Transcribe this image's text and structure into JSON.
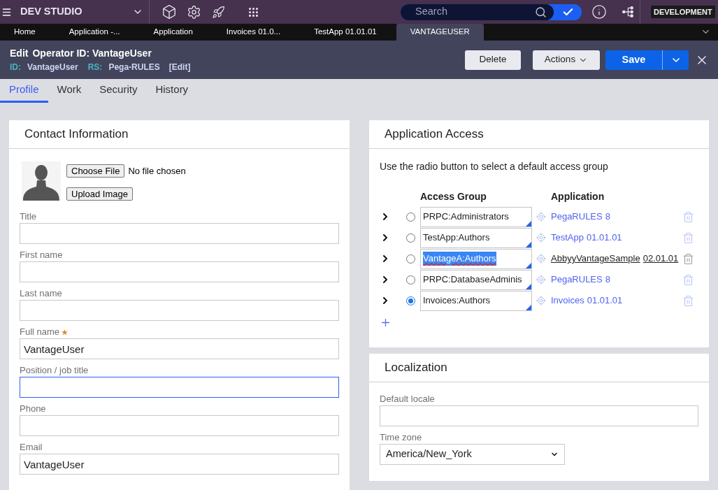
{
  "top_bar": {
    "title": "DEV STUDIO",
    "search": {
      "placeholder": "Search"
    },
    "environment": "DEVELOPMENT"
  },
  "document_tabs": [
    {
      "label": "Home",
      "selected": false
    },
    {
      "label": "Application -...",
      "selected": false
    },
    {
      "label": "Application",
      "selected": false
    },
    {
      "label": "Invoices 01.0...",
      "selected": false
    },
    {
      "label": "TestApp 01.01.01",
      "selected": false
    },
    {
      "label": "VANTAGEUSER",
      "selected": true
    }
  ],
  "header": {
    "action": "Edit",
    "title": "Operator ID: VantageUser",
    "id_label": "ID:",
    "id_value": "VantageUser",
    "rs_label": "RS:",
    "rs_value": "Pega-RULES",
    "edit_link": "[Edit]",
    "buttons": [
      {
        "label": "Delete",
        "kind": "secondary"
      },
      {
        "label": "Actions",
        "kind": "menu"
      },
      {
        "label": "Save",
        "kind": "split_primary"
      }
    ]
  },
  "section_tabs": [
    {
      "label": "Profile",
      "selected": true
    },
    {
      "label": "Work",
      "selected": false
    },
    {
      "label": "Security",
      "selected": false
    },
    {
      "label": "History",
      "selected": false
    }
  ],
  "contact_information": {
    "title": "Contact Information",
    "photo_upload": {
      "choose_button": "Choose File",
      "file_status": "No file chosen",
      "upload_button": "Upload Image"
    },
    "fields": [
      {
        "label": "Title",
        "required": false,
        "focused": false
      },
      {
        "label": "First name",
        "required": false,
        "focused": false
      },
      {
        "label": "Last name",
        "required": false,
        "focused": false
      },
      {
        "label": "Full name",
        "required": true,
        "focused": false,
        "value": "VantageUser"
      },
      {
        "label": "Position / job title",
        "required": false,
        "focused": true
      },
      {
        "label": "Phone",
        "required": false,
        "focused": false
      },
      {
        "label": "Email",
        "required": false,
        "focused": false,
        "value": "VantageUser"
      }
    ]
  },
  "application_access": {
    "title": "Application Access",
    "instructions": "Use the radio button to select a default access group",
    "columns": [
      "Access Group",
      "Application"
    ],
    "rows": [
      {
        "expanded": false,
        "selected": false,
        "access_group": "PRPC:Administrators",
        "text_highlighted": false,
        "spelling_flagged": false,
        "hovered": false,
        "application": "PegaRULES",
        "version": "8"
      },
      {
        "expanded": false,
        "selected": false,
        "access_group": "TestApp:Authors",
        "text_highlighted": false,
        "spelling_flagged": false,
        "hovered": false,
        "application": "TestApp",
        "version": "01.01.01"
      },
      {
        "expanded": false,
        "selected": false,
        "access_group": "VantageA:Authors",
        "text_highlighted": true,
        "spelling_flagged": true,
        "hovered": true,
        "application": "AbbyyVantageSample",
        "version": "02.01.01"
      },
      {
        "expanded": false,
        "selected": false,
        "access_group": "PRPC:DatabaseAdminis",
        "text_highlighted": false,
        "spelling_flagged": false,
        "hovered": false,
        "application": "PegaRULES",
        "version": "8"
      },
      {
        "expanded": false,
        "selected": true,
        "access_group": "Invoices:Authors",
        "text_highlighted": false,
        "spelling_flagged": false,
        "hovered": false,
        "application": "Invoices",
        "version": "01.01.01"
      }
    ]
  },
  "localization": {
    "title": "Localization",
    "fields": [
      {
        "label": "Default locale",
        "kind": "text"
      },
      {
        "label": "Time zone",
        "kind": "select",
        "value": "America/New_York"
      }
    ]
  }
}
